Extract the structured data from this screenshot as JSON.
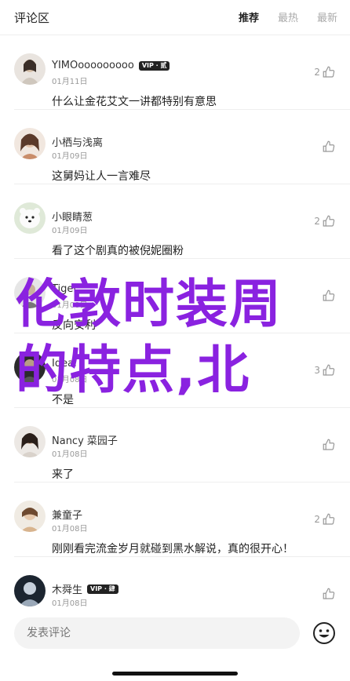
{
  "header": {
    "title": "评论区",
    "tabs": [
      {
        "label": "推荐",
        "active": true
      },
      {
        "label": "最热",
        "active": false
      },
      {
        "label": "最新",
        "active": false
      }
    ]
  },
  "comments": [
    {
      "name": "YIMOooooooooo",
      "badge": "VIP · 贰",
      "date": "01月11日",
      "text": "什么让金花艾文一讲都特别有意思",
      "likes": "2"
    },
    {
      "name": "小栖与浅离",
      "badge": "",
      "date": "01月09日",
      "text": "这舅妈让人一言难尽",
      "likes": ""
    },
    {
      "name": "小眼睛葱",
      "badge": "",
      "date": "01月09日",
      "text": "看了这个剧真的被倪妮圈粉",
      "likes": "2"
    },
    {
      "name": "Tiger",
      "badge": "",
      "date": "01月08日",
      "text": "反向安利",
      "likes": ""
    },
    {
      "name": "Ideal",
      "badge": "",
      "date": "01月08日",
      "text": "不是",
      "likes": "3"
    },
    {
      "name": "Nancy 菜园子",
      "badge": "",
      "date": "01月08日",
      "text": "来了",
      "likes": ""
    },
    {
      "name": "兼童子",
      "badge": "",
      "date": "01月08日",
      "text": "刚刚看完流金岁月就碰到黑水解说，真的很开心！",
      "likes": "2"
    },
    {
      "name": "木舜生",
      "badge": "VIP · 肆",
      "date": "01月08日",
      "text": "",
      "likes": ""
    }
  ],
  "overlay": {
    "line1": "伦敦时装周",
    "line2": "的特点,北"
  },
  "bottom": {
    "placeholder": "发表评论"
  },
  "icons": {
    "like": "thumb-up-icon",
    "emoji": "smiley-icon"
  },
  "colors": {
    "overlay": "#8a22e0"
  }
}
